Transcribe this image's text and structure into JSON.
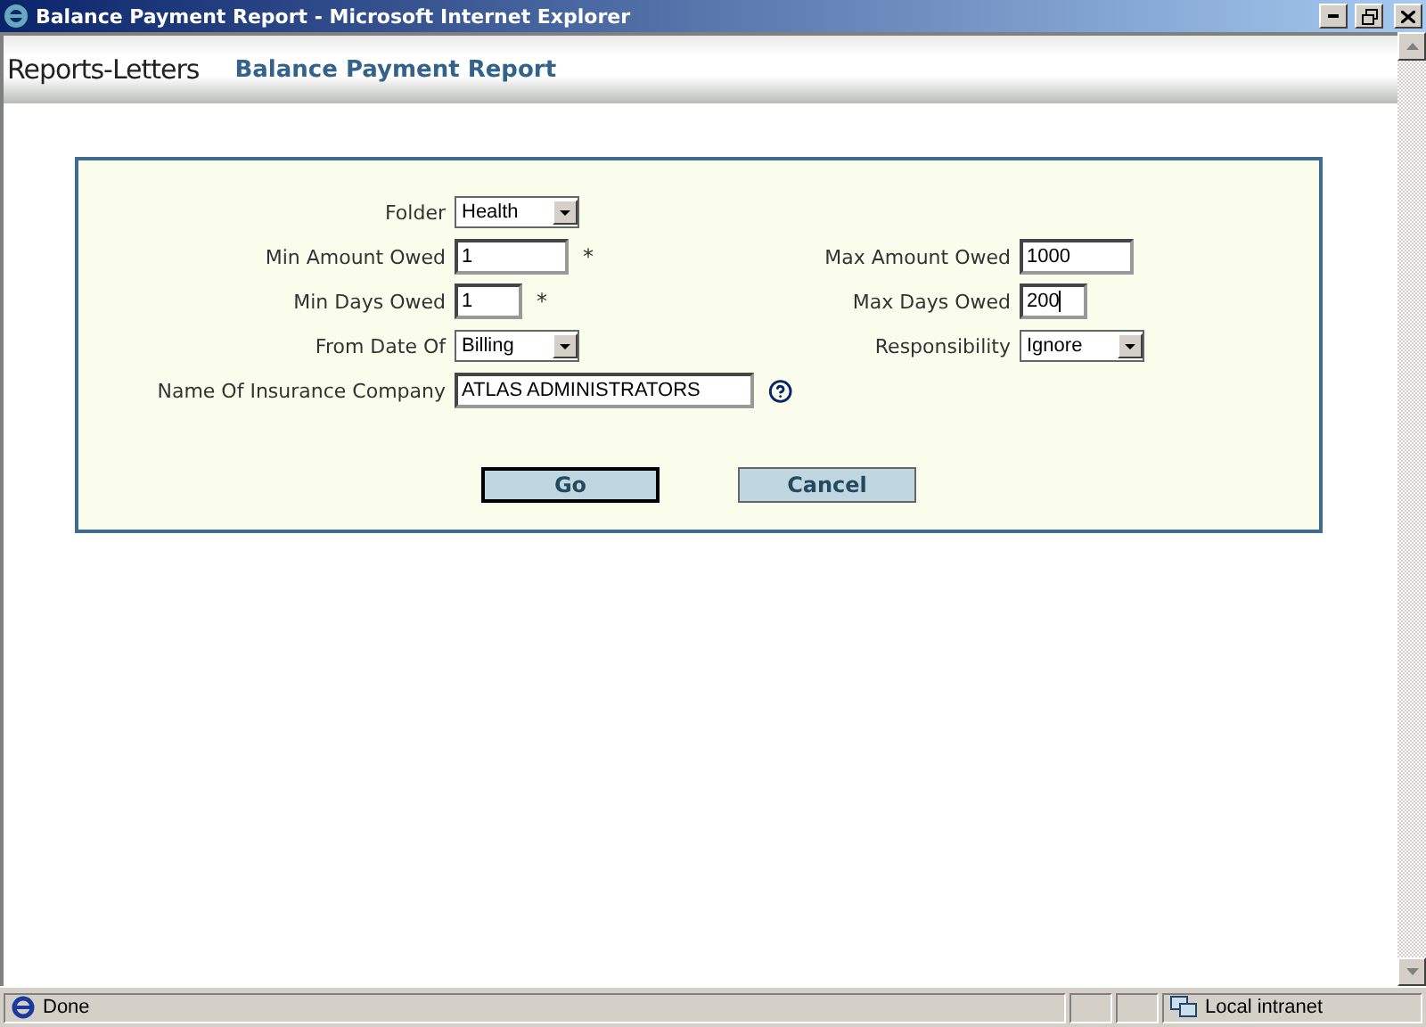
{
  "window": {
    "title": "Balance Payment Report - Microsoft Internet Explorer"
  },
  "header": {
    "section": "Reports-Letters",
    "page_title": "Balance Payment Report"
  },
  "form": {
    "rows": [
      {
        "left": {
          "label": "Folder",
          "kind": "select",
          "value": "Health"
        }
      },
      {
        "left": {
          "label": "Min Amount Owed",
          "kind": "text",
          "value": "1",
          "required_mark": "*"
        },
        "right": {
          "label": "Max Amount Owed",
          "kind": "text",
          "value": "1000"
        }
      },
      {
        "left": {
          "label": "Min Days Owed",
          "kind": "text",
          "value": "1",
          "required_mark": "*"
        },
        "right": {
          "label": "Max Days Owed",
          "kind": "text",
          "value": "200",
          "focused": true
        }
      },
      {
        "left": {
          "label": "From Date Of",
          "kind": "select",
          "value": "Billing"
        },
        "right": {
          "label": "Responsibility",
          "kind": "select",
          "value": "Ignore"
        }
      },
      {
        "left": {
          "label": "Name Of Insurance Company",
          "kind": "text",
          "value": "ATLAS ADMINISTRATORS",
          "help": true
        }
      }
    ],
    "buttons": [
      {
        "label": "Go",
        "default": true
      },
      {
        "label": "Cancel",
        "default": false
      }
    ]
  },
  "status_bar": {
    "text": "Done",
    "zone": "Local intranet"
  }
}
